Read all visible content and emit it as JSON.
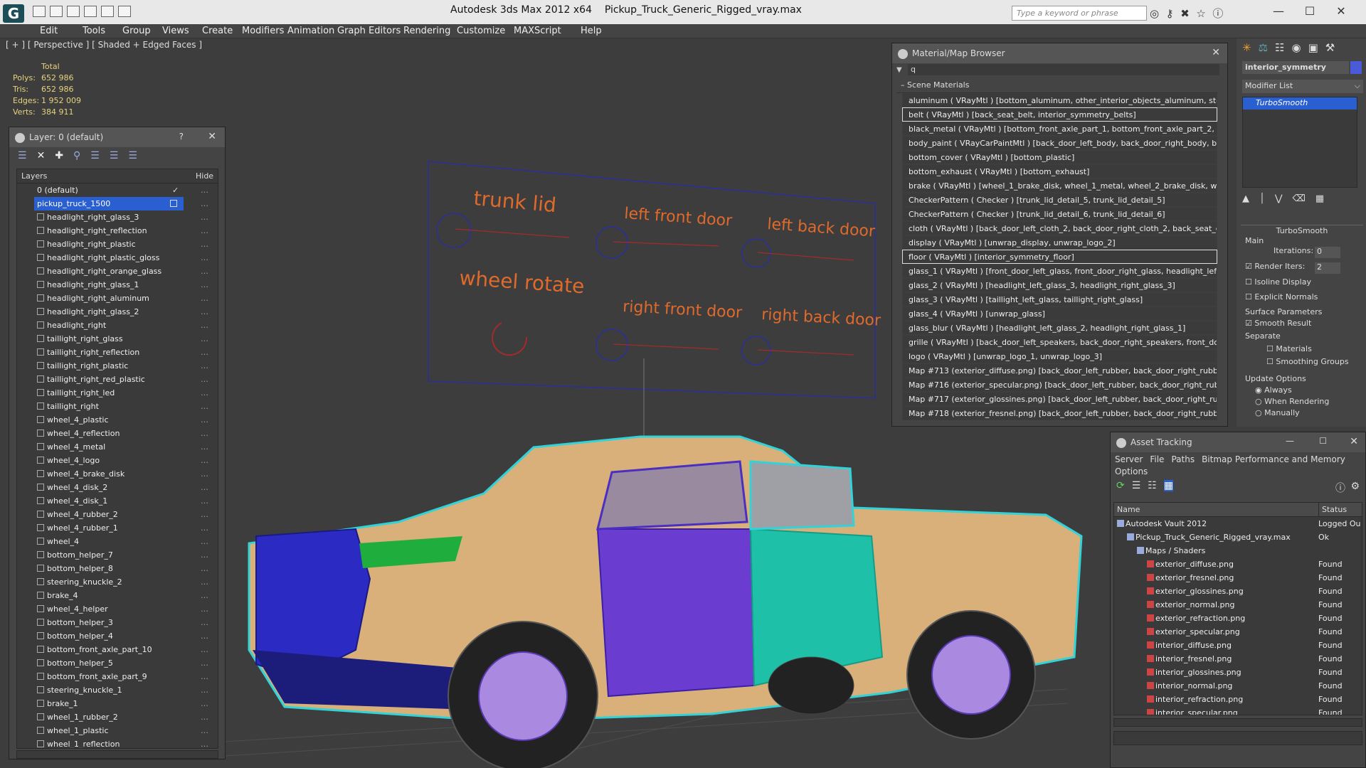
{
  "app": {
    "title": "Autodesk 3ds Max  2012 x64",
    "file": "Pickup_Truck_Generic_Rigged_vray.max",
    "search_placeholder": "Type a keyword or phrase"
  },
  "menu": [
    "Edit",
    "Tools",
    "Group",
    "Views",
    "Create",
    "Modifiers",
    "Animation",
    "Graph Editors",
    "Rendering",
    "Customize",
    "MAXScript",
    "Help"
  ],
  "viewport": {
    "label": "[ + ] [ Perspective ] [ Shaded + Edged Faces ]",
    "stats_header": "Total",
    "stats": [
      {
        "k": "Polys:",
        "v": "652 986"
      },
      {
        "k": "Tris:",
        "v": "652 986"
      },
      {
        "k": "Edges:",
        "v": "1 952 009"
      },
      {
        "k": "Verts:",
        "v": "384 911"
      }
    ],
    "rig_labels": [
      "trunk lid",
      "left front door",
      "left back door",
      "wheel rotate",
      "right front door",
      "right back door"
    ]
  },
  "layers": {
    "title": "Layer: 0 (default)",
    "help": "?",
    "col_layers": "Layers",
    "col_hide": "Hide",
    "root0": "0 (default)",
    "root1": "pickup_truck_1500",
    "items": [
      "headlight_right_glass_3",
      "headlight_right_reflection",
      "headlight_right_plastic",
      "headlight_right_plastic_gloss",
      "headlight_right_orange_glass",
      "headlight_right_glass_1",
      "headlight_right_aluminum",
      "headlight_right_glass_2",
      "headlight_right",
      "taillight_right_glass",
      "taillight_right_reflection",
      "taillight_right_plastic",
      "taillight_right_red_plastic",
      "taillight_right_led",
      "taillight_right",
      "wheel_4_plastic",
      "wheel_4_reflection",
      "wheel_4_metal",
      "wheel_4_logo",
      "wheel_4_brake_disk",
      "wheel_4_disk_2",
      "wheel_4_disk_1",
      "wheel_4_rubber_2",
      "wheel_4_rubber_1",
      "wheel_4",
      "bottom_helper_7",
      "bottom_helper_8",
      "steering_knuckle_2",
      "brake_4",
      "wheel_4_helper",
      "bottom_helper_3",
      "bottom_helper_4",
      "bottom_front_axle_part_10",
      "bottom_helper_5",
      "bottom_front_axle_part_9",
      "steering_knuckle_1",
      "brake_1",
      "wheel_1_rubber_2",
      "wheel_1_plastic",
      "wheel_1_reflection"
    ]
  },
  "material_browser": {
    "title": "Material/Map Browser",
    "search_value": "q",
    "group": "Scene Materials",
    "items": [
      "aluminum  ( VRayMtl ) [bottom_aluminum, other_interior_objects_aluminum, steeri...",
      "belt  ( VRayMtl ) [back_seat_belt, interior_symmetry_belts]",
      "black_metal  ( VRayMtl ) [bottom_front_axle_part_1, bottom_front_axle_part_2, bo...",
      "body_paint  ( VRayCarPaintMtl ) [back_door_left_body, back_door_right_body, bod...",
      "bottom_cover  ( VRayMtl ) [bottom_plastic]",
      "bottom_exhaust  ( VRayMtl ) [bottom_exhaust]",
      "brake  ( VRayMtl ) [wheel_1_brake_disk, wheel_1_metal, wheel_2_brake_disk, wh...",
      "CheckerPattern  ( Checker ) [trunk_lid_detail_5, trunk_lid_detail_5]",
      "CheckerPattern  ( Checker ) [trunk_lid_detail_6, trunk_lid_detail_6]",
      "cloth  ( VRayMtl ) [back_door_left_cloth_2, back_door_right_cloth_2, back_seat_cl...",
      "display  ( VRayMtl ) [unwrap_display, unwrap_logo_2]",
      "floor  ( VRayMtl ) [interior_symmetry_floor]",
      "glass_1  ( VRayMtl ) [front_door_left_glass, front_door_right_glass, headlight_left_...",
      "glass_2  ( VRayMtl ) [headlight_left_glass_3, headlight_right_glass_3]",
      "glass_3  ( VRayMtl ) [taillight_left_glass, taillight_right_glass]",
      "glass_4  ( VRayMtl ) [unwrap_glass]",
      "glass_blur  ( VRayMtl ) [headlight_left_glass_2, headlight_right_glass_1]",
      "grille  ( VRayMtl ) [back_door_left_speakers, back_door_right_speakers, front_door...",
      "logo  ( VRayMtl ) [unwrap_logo_1, unwrap_logo_3]",
      "Map #713 (exterior_diffuse.png) [back_door_left_rubber, back_door_right_rubber, ...",
      "Map #716 (exterior_specular.png) [back_door_left_rubber, back_door_right_rubbe...",
      "Map #717 (exterior_glossines.png) [back_door_left_rubber, back_door_right_rubb...",
      "Map #718 (exterior_fresnel.png) [back_door_left_rubber, back_door_right_rubber, ..."
    ]
  },
  "command_panel": {
    "object_name": "interior_symmetry",
    "modifier_list": "Modifier List",
    "stack_item": "TurboSmooth",
    "rollout_title": "TurboSmooth",
    "main": "Main",
    "iterations_label": "Iterations:",
    "iterations_value": "0",
    "render_iters_label": "Render Iters:",
    "render_iters_value": "2",
    "isoline": "Isoline Display",
    "explicit": "Explicit Normals",
    "surface_params": "Surface Parameters",
    "smooth_result": "Smooth Result",
    "separate": "Separate",
    "materials": "Materials",
    "smoothing_groups": "Smoothing Groups",
    "update_options": "Update Options",
    "always": "Always",
    "when_rendering": "When Rendering",
    "manually": "Manually"
  },
  "asset_tracking": {
    "title": "Asset Tracking",
    "menu": [
      "Server",
      "File",
      "Paths",
      "Bitmap Performance and Memory",
      "Options"
    ],
    "col_name": "Name",
    "col_status": "Status",
    "rows": [
      {
        "name": "Autodesk Vault 2012",
        "status": "Logged Ou",
        "level": 0
      },
      {
        "name": "Pickup_Truck_Generic_Rigged_vray.max",
        "status": "Ok",
        "level": 1
      },
      {
        "name": "Maps / Shaders",
        "status": "",
        "level": 2
      },
      {
        "name": "exterior_diffuse.png",
        "status": "Found",
        "level": 3
      },
      {
        "name": "exterior_fresnel.png",
        "status": "Found",
        "level": 3
      },
      {
        "name": "exterior_glossines.png",
        "status": "Found",
        "level": 3
      },
      {
        "name": "exterior_normal.png",
        "status": "Found",
        "level": 3
      },
      {
        "name": "exterior_refraction.png",
        "status": "Found",
        "level": 3
      },
      {
        "name": "exterior_specular.png",
        "status": "Found",
        "level": 3
      },
      {
        "name": "interior_diffuse.png",
        "status": "Found",
        "level": 3
      },
      {
        "name": "interior_fresnel.png",
        "status": "Found",
        "level": 3
      },
      {
        "name": "interior_glossines.png",
        "status": "Found",
        "level": 3
      },
      {
        "name": "interior_normal.png",
        "status": "Found",
        "level": 3
      },
      {
        "name": "interior_refraction.png",
        "status": "Found",
        "level": 3
      },
      {
        "name": "interior_specular.png",
        "status": "Found",
        "level": 3
      }
    ]
  },
  "colors": {
    "accent": "#2a5fd1",
    "rig": "#e06a2c",
    "wire_body": "#d9b07a",
    "wire_blue": "#3030c8",
    "wire_cyan": "#31d3d8"
  }
}
